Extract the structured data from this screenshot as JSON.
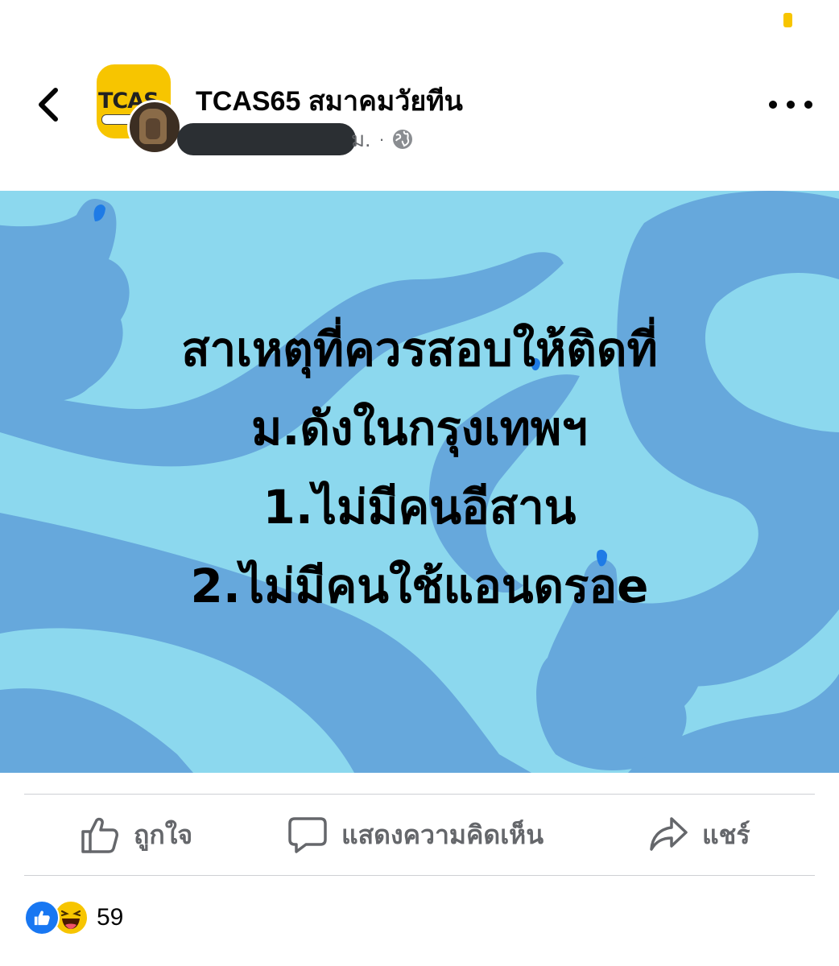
{
  "header": {
    "page_name": "TCAS65 สมาคมวัยทีน",
    "meta_suffix": "ม.",
    "meta_separator": "·",
    "page_logo_text": "TCAS",
    "icons": [
      "chevron-left-icon",
      "globe-icon",
      "more-icon"
    ]
  },
  "post": {
    "lines": [
      "สาเหตุที่ควรสอบให้ติดที่",
      "ม.ดังในกรุงเทพฯ",
      "1.ไม่มีคนอีสาน",
      "2.ไม่มีคนใช้แอนดรอe"
    ],
    "background_color": "#8cd8ee",
    "pattern_color": "#66a8dc",
    "nail_color": "#1e7be6"
  },
  "actions": {
    "like_label": "ถูกใจ",
    "comment_label": "แสดงความคิดเห็น",
    "share_label": "แชร์"
  },
  "reactions": {
    "count": "59",
    "types": [
      "like",
      "haha"
    ],
    "like_color": "#1877f2",
    "haha_color": "#f7c500"
  },
  "colors": {
    "secondary_text": "#65676b",
    "accent_yellow": "#f7c500"
  }
}
